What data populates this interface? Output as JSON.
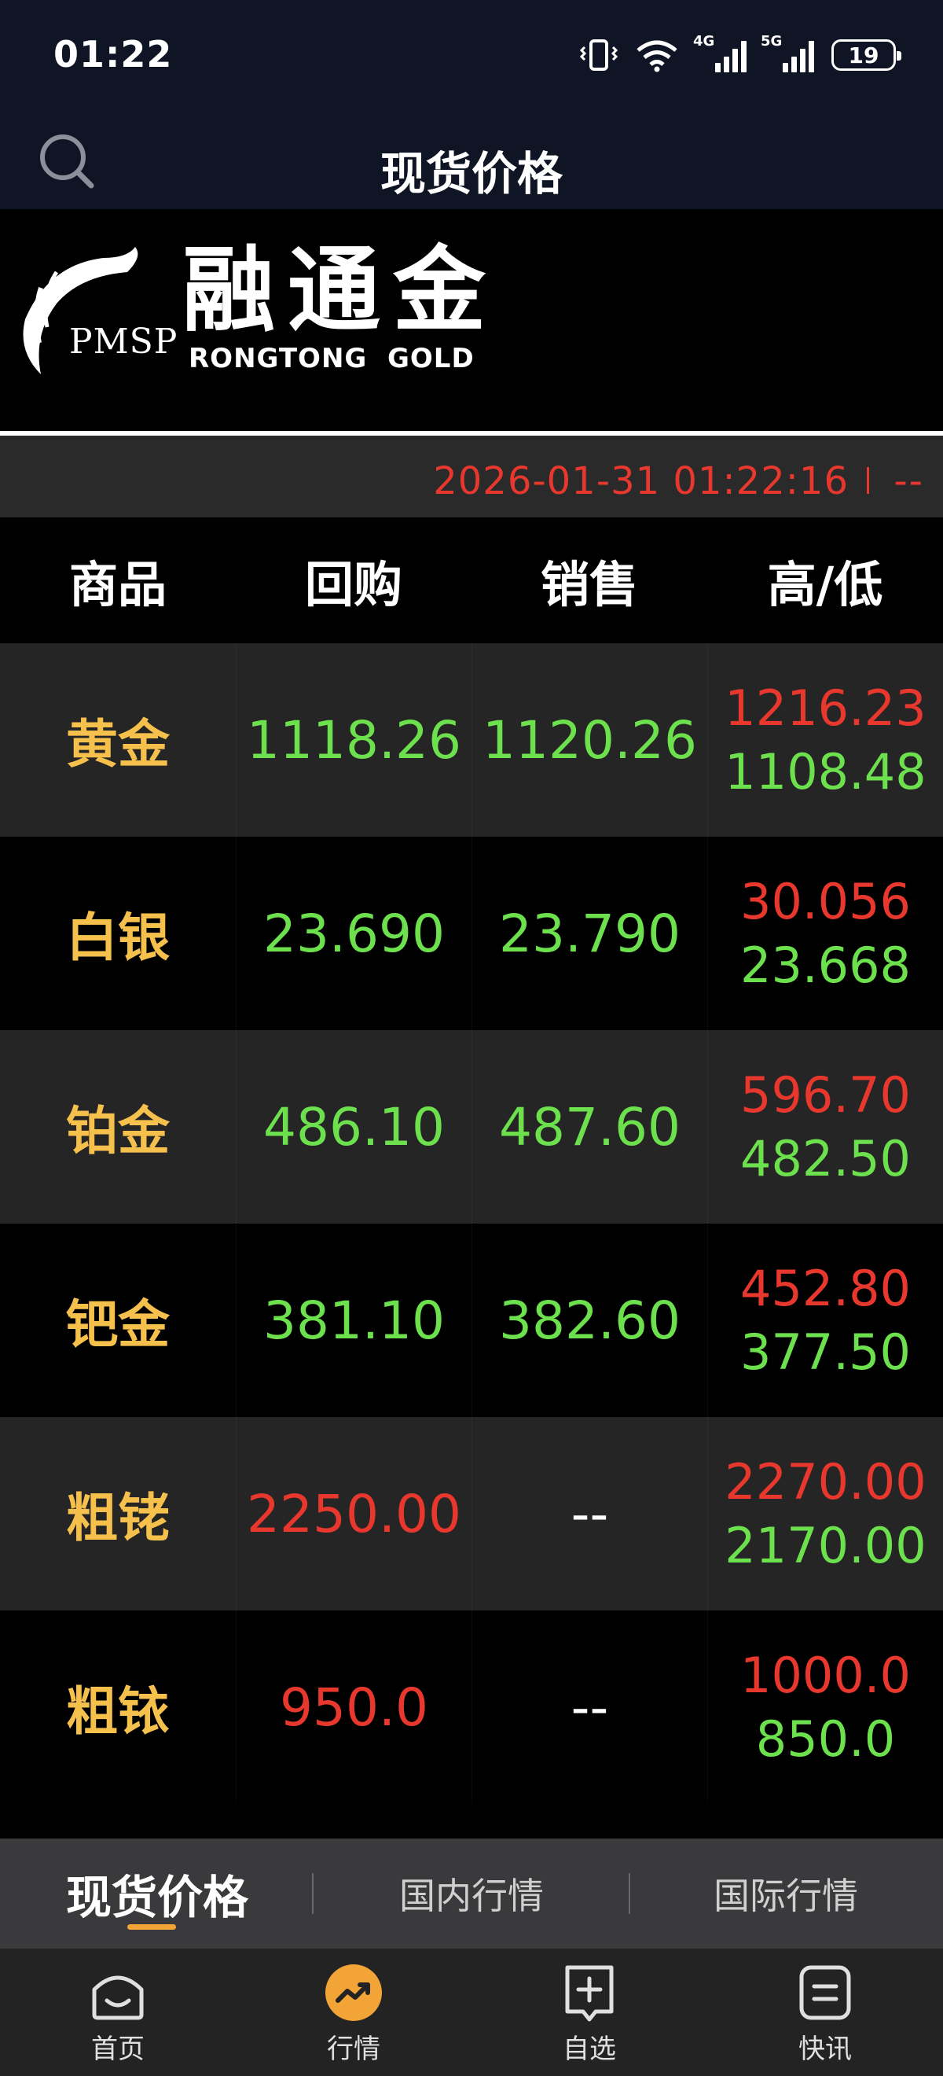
{
  "status_bar": {
    "time": "01:22",
    "signal1_label": "4G",
    "signal2_label": "5G",
    "battery": "19"
  },
  "header": {
    "title": "现货价格"
  },
  "logo": {
    "mark": "PMSP",
    "brand_cn": "融通金",
    "brand_en": "RONGTONG  GOLD"
  },
  "timestamp": {
    "datetime": "2026-01-31 01:22:16",
    "status": "--"
  },
  "table": {
    "headers": [
      "商品",
      "回购",
      "销售",
      "高/低"
    ],
    "rows": [
      {
        "name": "黄金",
        "buyback": "1118.26",
        "sell": "1120.26",
        "high": "1216.23",
        "low": "1108.48",
        "buyback_color": "g",
        "sell_color": "g"
      },
      {
        "name": "白银",
        "buyback": "23.690",
        "sell": "23.790",
        "high": "30.056",
        "low": "23.668",
        "buyback_color": "g",
        "sell_color": "g"
      },
      {
        "name": "铂金",
        "buyback": "486.10",
        "sell": "487.60",
        "high": "596.70",
        "low": "482.50",
        "buyback_color": "g",
        "sell_color": "g"
      },
      {
        "name": "钯金",
        "buyback": "381.10",
        "sell": "382.60",
        "high": "452.80",
        "low": "377.50",
        "buyback_color": "g",
        "sell_color": "g"
      },
      {
        "name": "粗铑",
        "buyback": "2250.00",
        "sell": "--",
        "high": "2270.00",
        "low": "2170.00",
        "buyback_color": "r",
        "sell_color": "w"
      },
      {
        "name": "粗铱",
        "buyback": "950.0",
        "sell": "--",
        "high": "1000.0",
        "low": "850.0",
        "buyback_color": "r",
        "sell_color": "w"
      }
    ]
  },
  "sub_tabs": [
    {
      "label": "现货价格",
      "active": true
    },
    {
      "label": "国内行情",
      "active": false
    },
    {
      "label": "国际行情",
      "active": false
    }
  ],
  "bottom_nav": [
    {
      "label": "首页",
      "icon": "home-icon"
    },
    {
      "label": "行情",
      "icon": "market-trend-icon"
    },
    {
      "label": "自选",
      "icon": "add-watchlist-icon"
    },
    {
      "label": "快讯",
      "icon": "news-icon"
    }
  ],
  "colors": {
    "rise": "#e8382e",
    "fall": "#6de04e",
    "commodity_name": "#f6c04c",
    "accent": "#f3a437"
  }
}
